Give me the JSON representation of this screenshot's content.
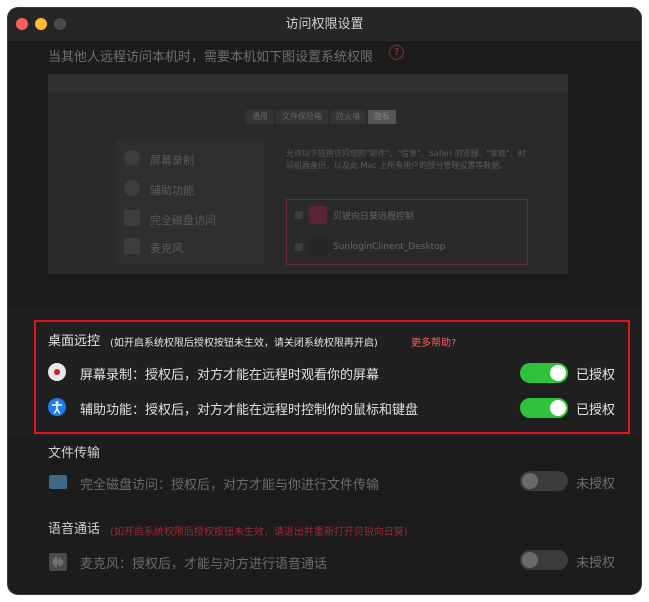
{
  "window": {
    "title": "访问权限设置"
  },
  "intro": {
    "text": "当其他人远程访问本机时，需要本机如下图设置系统权限",
    "help_icon": "question-circle-icon",
    "help_glyph": "?"
  },
  "preview": {
    "tabs": [
      "通用",
      "文件保险箱",
      "防火墙",
      "隐私"
    ],
    "sidebar": [
      "屏幕录制",
      "辅助功能",
      "完全磁盘访问",
      "麦克风"
    ],
    "description": "允许以下应用访问您的\"邮件\"、\"信息\"、Safari 浏览器、\"家庭\"、时间机器备份，以及此 Mac 上所有用户的部分管理设置等数据。",
    "apps": [
      "贝锐向日葵远程控制",
      "SunloginClinent_Desktop"
    ]
  },
  "desktop_control": {
    "title": "桌面远控",
    "note": "(如开启系统权限后授权按钮未生效，请关闭系统权限再开启)",
    "more_help": "更多帮助?",
    "items": [
      {
        "label": "屏幕录制：授权后，对方才能在远程时观看你的屏幕",
        "icon": "screen-record-icon",
        "state": "已授权",
        "enabled": true
      },
      {
        "label": "辅助功能：授权后，对方才能在远程时控制你的鼠标和键盘",
        "icon": "accessibility-icon",
        "state": "已授权",
        "enabled": true
      }
    ]
  },
  "file_transfer": {
    "title": "文件传输",
    "items": [
      {
        "label": "完全磁盘访问：授权后，对方才能与你进行文件传输",
        "icon": "folder-icon",
        "state": "未授权",
        "enabled": false
      }
    ]
  },
  "voice_call": {
    "title": "语音通话",
    "note": "(如开启系统权限后授权按钮未生效，请退出并重新打开贝锐向日葵)",
    "items": [
      {
        "label": "麦克风：授权后，才能与对方进行语音通话",
        "icon": "microphone-icon",
        "state": "未授权",
        "enabled": false
      }
    ]
  },
  "colors": {
    "accent_green": "#30c23a",
    "highlight_red": "#e0141e",
    "link_red": "#ff5a63"
  }
}
